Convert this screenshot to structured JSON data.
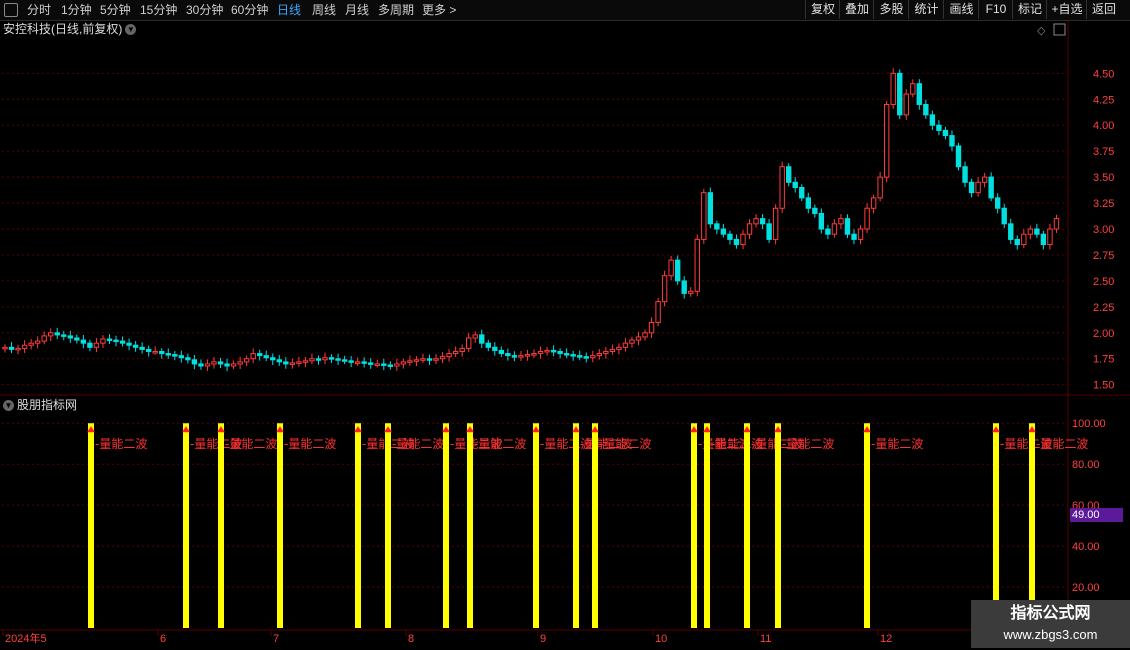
{
  "toolbar": {
    "left_items": [
      "分时",
      "1分钟",
      "5分钟",
      "15分钟",
      "30分钟",
      "60分钟",
      "日线",
      "周线",
      "月线",
      "多周期",
      "更多 >"
    ],
    "active": "日线",
    "right_items": [
      "复权",
      "叠加",
      "多股",
      "统计",
      "画线",
      "F10",
      "标记",
      "+自选",
      "返回"
    ]
  },
  "main_panel": {
    "title": "安控科技(日线,前复权)",
    "y_ticks": [
      "4.50",
      "4.25",
      "4.00",
      "3.75",
      "3.50",
      "3.25",
      "3.00",
      "2.75",
      "2.50",
      "2.25",
      "2.00",
      "1.75",
      "1.50"
    ]
  },
  "sub_panel": {
    "title": "股朋指标网",
    "y_ticks": [
      "100.00",
      "80.00",
      "60.00",
      "40.00",
      "20.00"
    ],
    "current_value": "49.00",
    "signal_label": "量能二波"
  },
  "x_axis": {
    "labels": [
      "2024年5",
      "6",
      "7",
      "8",
      "9",
      "10",
      "11",
      "12"
    ]
  },
  "watermark": {
    "line1": "指标公式网",
    "line2": "www.zbgs3.com"
  },
  "colors": {
    "up": "#ff3c3c",
    "down": "#00e0e0",
    "signal_bar": "#ffff00",
    "grid": "#5a0000",
    "axis_text": "#ff4040"
  },
  "chart_data": [
    {
      "type": "candlestick",
      "title": "安控科技(日线,前复权)",
      "ylim": [
        1.42,
        4.85
      ],
      "x_labels": [
        "2024年5",
        "6",
        "7",
        "8",
        "9",
        "10",
        "11",
        "12"
      ],
      "close": [
        1.86,
        1.84,
        1.85,
        1.88,
        1.9,
        1.92,
        1.97,
        2.0,
        1.98,
        1.97,
        1.95,
        1.93,
        1.9,
        1.86,
        1.9,
        1.94,
        1.93,
        1.92,
        1.9,
        1.88,
        1.86,
        1.84,
        1.82,
        1.82,
        1.8,
        1.79,
        1.78,
        1.76,
        1.74,
        1.7,
        1.68,
        1.7,
        1.72,
        1.7,
        1.68,
        1.7,
        1.72,
        1.75,
        1.8,
        1.78,
        1.76,
        1.74,
        1.72,
        1.7,
        1.71,
        1.72,
        1.73,
        1.75,
        1.74,
        1.76,
        1.75,
        1.74,
        1.73,
        1.72,
        1.72,
        1.71,
        1.7,
        1.7,
        1.69,
        1.68,
        1.7,
        1.72,
        1.73,
        1.74,
        1.75,
        1.74,
        1.75,
        1.77,
        1.8,
        1.82,
        1.85,
        1.95,
        1.98,
        1.9,
        1.86,
        1.83,
        1.8,
        1.78,
        1.77,
        1.78,
        1.79,
        1.8,
        1.82,
        1.83,
        1.82,
        1.8,
        1.79,
        1.78,
        1.77,
        1.76,
        1.78,
        1.8,
        1.82,
        1.84,
        1.86,
        1.9,
        1.93,
        1.96,
        2.0,
        2.1,
        2.3,
        2.55,
        2.7,
        2.5,
        2.38,
        2.4,
        2.9,
        3.35,
        3.05,
        3.0,
        2.95,
        2.9,
        2.85,
        2.95,
        3.05,
        3.1,
        3.05,
        2.9,
        3.2,
        3.6,
        3.45,
        3.4,
        3.3,
        3.2,
        3.15,
        3.0,
        2.95,
        3.05,
        3.1,
        2.95,
        2.9,
        3.0,
        3.2,
        3.3,
        3.5,
        4.2,
        4.5,
        4.1,
        4.3,
        4.4,
        4.2,
        4.1,
        4.0,
        3.95,
        3.9,
        3.8,
        3.6,
        3.45,
        3.35,
        3.45,
        3.5,
        3.3,
        3.2,
        3.05,
        2.9,
        2.85,
        2.95,
        3.0,
        2.95,
        2.85,
        3.0,
        3.1
      ]
    },
    {
      "type": "bar",
      "title": "股朋指标网",
      "ylim": [
        0,
        105
      ],
      "series": [
        {
          "name": "量能二波",
          "values": [
            100,
            100,
            100,
            100,
            100,
            100,
            100,
            100,
            100,
            100,
            100,
            100,
            100,
            100,
            100,
            100,
            100,
            100,
            100,
            100,
            100
          ]
        }
      ],
      "current_value": 49.0
    }
  ]
}
